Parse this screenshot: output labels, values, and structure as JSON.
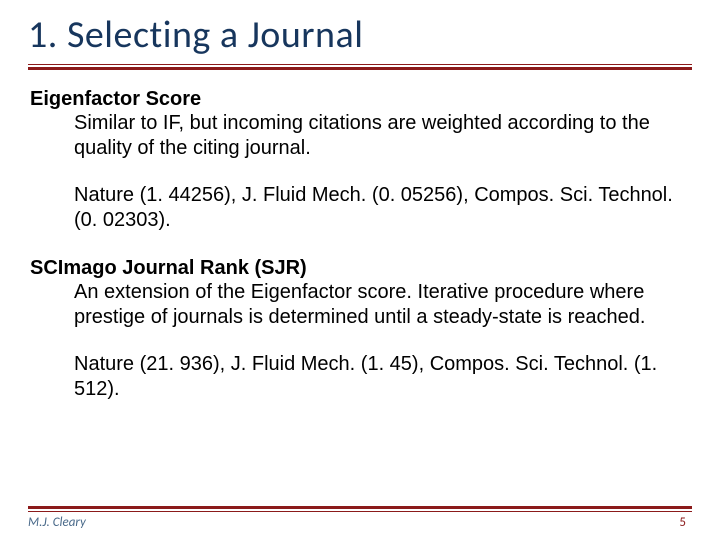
{
  "title": "1. Selecting a Journal",
  "sections": [
    {
      "heading": "Eigenfactor Score",
      "desc": "Similar to IF, but incoming citations are weighted according to the quality of the citing journal.",
      "data": "Nature (1. 44256), J. Fluid Mech. (0. 05256), Compos. Sci. Technol. (0. 02303)."
    },
    {
      "heading": "SCImago Journal Rank (SJR)",
      "desc": "An extension of the Eigenfactor score. Iterative procedure where prestige of journals is determined until a steady-state is reached.",
      "data": "Nature (21. 936), J. Fluid Mech. (1. 45), Compos. Sci. Technol. (1. 512)."
    }
  ],
  "footer": {
    "author": "M.J. Cleary",
    "page": "5"
  }
}
